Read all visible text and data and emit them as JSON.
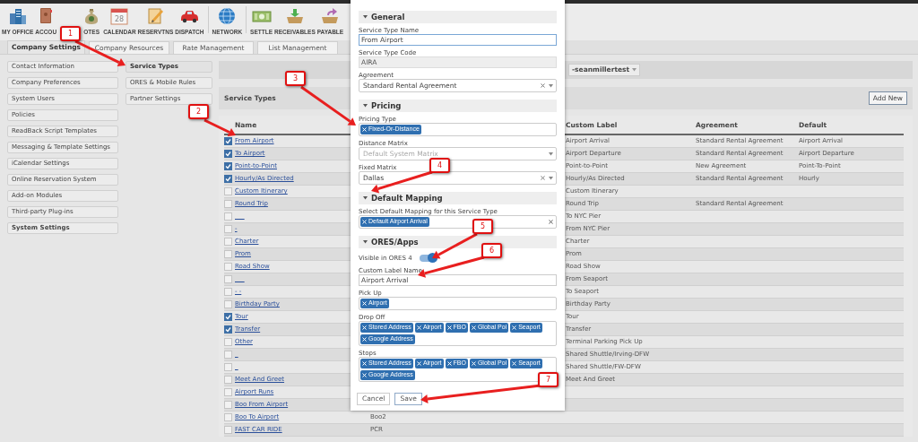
{
  "toolbar": [
    {
      "label": "MY OFFICE"
    },
    {
      "label": "ACCOU"
    },
    {
      "label": "OTES"
    },
    {
      "label": "CALENDAR",
      "icon_text": "28"
    },
    {
      "label": "RESERVTNS"
    },
    {
      "label": "DISPATCH"
    },
    {
      "label": "NETWORK"
    },
    {
      "label": "SETTLE"
    },
    {
      "label": "RECEIVABLES"
    },
    {
      "label": "PAYABLE"
    }
  ],
  "tabs": [
    {
      "label": "Company Settings",
      "selected": true
    },
    {
      "label": "Company Resources",
      "selected": false
    },
    {
      "label": "Rate Management",
      "selected": false
    },
    {
      "label": "List Management",
      "selected": false
    }
  ],
  "sidebar": {
    "items": [
      {
        "label": "Contact Information",
        "kind": "item"
      },
      {
        "label": "Company Preferences",
        "kind": "item"
      },
      {
        "label": "System Users",
        "kind": "item"
      },
      {
        "label": "Policies",
        "kind": "item"
      },
      {
        "label": "ReadBack Script Templates",
        "kind": "item"
      },
      {
        "label": "Messaging & Template Settings",
        "kind": "item"
      },
      {
        "label": "iCalendar Settings",
        "kind": "item"
      },
      {
        "label": "Online Reservation System",
        "kind": "item"
      },
      {
        "label": "Add-on Modules",
        "kind": "item"
      },
      {
        "label": "Third-party Plug-ins",
        "kind": "item"
      },
      {
        "label": "System Settings",
        "kind": "heading"
      }
    ]
  },
  "subnav": {
    "items": [
      {
        "label": "Service Types",
        "selected": true
      },
      {
        "label": "ORES & Mobile Rules",
        "selected": false
      },
      {
        "label": "Partner Settings",
        "selected": false
      }
    ]
  },
  "company_dropdown": {
    "value": "-seanmillertest"
  },
  "section": {
    "title": "Service Types",
    "add_button": "Add New"
  },
  "table": {
    "columns": [
      {
        "label": "Name"
      },
      {
        "label": "Custom Label"
      },
      {
        "label": "Agreement"
      },
      {
        "label": "Default"
      }
    ],
    "rows": [
      {
        "checked": true,
        "name": "From Airport",
        "custom_label": "Airport Arrival",
        "agreement": "Standard Rental Agreement",
        "default": "Airport Arrival"
      },
      {
        "checked": true,
        "name": "To Airport",
        "custom_label": "Airport Departure",
        "agreement": "Standard Rental Agreement",
        "default": "Airport Departure"
      },
      {
        "checked": true,
        "name": "Point-to-Point",
        "custom_label": "Point-to-Point",
        "agreement": "New Agreement",
        "default": "Point-To-Point"
      },
      {
        "checked": true,
        "name": "Hourly/As Directed",
        "custom_label": "Hourly/As Directed",
        "agreement": "Standard Rental Agreement",
        "default": "Hourly"
      },
      {
        "checked": false,
        "name": "Custom Itinerary",
        "custom_label": "Custom Itinerary"
      },
      {
        "checked": false,
        "name": "Round Trip",
        "custom_label": "Round Trip",
        "agreement": "Standard Rental Agreement"
      },
      {
        "checked": false,
        "name": "___",
        "custom_label": "To NYC Pier"
      },
      {
        "checked": false,
        "name": "-",
        "custom_label": "From NYC Pier"
      },
      {
        "checked": false,
        "name": "Charter",
        "custom_label": "Charter"
      },
      {
        "checked": false,
        "name": "Prom",
        "custom_label": "Prom"
      },
      {
        "checked": false,
        "name": "Road Show",
        "custom_label": "Road Show"
      },
      {
        "checked": false,
        "name": "___",
        "custom_label": "From Seaport"
      },
      {
        "checked": false,
        "name": "- -",
        "custom_label": "To Seaport"
      },
      {
        "checked": false,
        "name": "Birthday Party",
        "custom_label": "Birthday Party"
      },
      {
        "checked": true,
        "name": "Tour",
        "custom_label": "Tour"
      },
      {
        "checked": true,
        "name": "Transfer",
        "custom_label": "Transfer"
      },
      {
        "checked": false,
        "name": "Other",
        "custom_label": "Terminal Parking Pick Up"
      },
      {
        "checked": false,
        "name": "_",
        "custom_label": "Shared Shuttle/Irving-DFW"
      },
      {
        "checked": false,
        "name": "_",
        "custom_label": "Shared Shuttle/FW-DFW"
      },
      {
        "checked": false,
        "name": "Meet And Greet",
        "custom_label": "Meet And Greet"
      },
      {
        "checked": false,
        "name": "Airport Runs"
      },
      {
        "checked": false,
        "name": "Boo From Airport"
      },
      {
        "checked": false,
        "name": "Boo To Airport",
        "code": "Boo2"
      },
      {
        "checked": false,
        "name": "FAST CAR RIDE",
        "code": "PCR"
      }
    ]
  },
  "modal": {
    "sections": [
      {
        "title": "General",
        "fields": [
          {
            "kind": "text",
            "label": "Service Type Name",
            "value": "From Airport",
            "focused": true,
            "disabled": false
          },
          {
            "kind": "text",
            "label": "Service Type Code",
            "value": "AIRA",
            "focused": false,
            "disabled": true
          },
          {
            "kind": "select",
            "label": "Agreement",
            "value": "Standard Rental Agreement",
            "clearable": true
          }
        ]
      },
      {
        "title": "Pricing",
        "fields": [
          {
            "kind": "tags",
            "label": "Pricing Type",
            "tags": [
              "Fixed-Or-Distance"
            ],
            "clearable": false
          },
          {
            "kind": "select",
            "label": "Distance Matrix",
            "placeholder": "Default System Matrix",
            "clearable": false
          },
          {
            "kind": "select",
            "label": "Fixed Matrix",
            "value": "Dallas",
            "clearable": true
          }
        ]
      },
      {
        "title": "Default Mapping",
        "fields": [
          {
            "kind": "tags",
            "label": "Select Default Mapping for this Service Type",
            "tags": [
              "Default Airport Arrival"
            ],
            "clearable": true
          }
        ]
      },
      {
        "title": "ORES/Apps",
        "fields": [
          {
            "kind": "toggle",
            "label": "Visible in ORES 4",
            "on": true
          },
          {
            "kind": "text",
            "label": "Custom Label Name",
            "value": "Airport Arrival",
            "focused": false,
            "disabled": false
          },
          {
            "kind": "tags",
            "label": "Pick Up",
            "tags": [
              "Airport"
            ],
            "clearable": false
          },
          {
            "kind": "tags",
            "label": "Drop Off",
            "tags": [
              "Stored Address",
              "Airport",
              "FBO",
              "Global Poi",
              "Seaport",
              "Google Address"
            ],
            "clearable": false
          },
          {
            "kind": "tags",
            "label": "Stops",
            "tags": [
              "Stored Address",
              "Airport",
              "FBO",
              "Global Poi",
              "Seaport",
              "Google Address"
            ]
          }
        ]
      }
    ],
    "buttons": [
      {
        "label": "Cancel",
        "kind": "cancel"
      },
      {
        "label": "Save",
        "kind": "save"
      }
    ]
  },
  "callouts": [
    {
      "number": "1"
    },
    {
      "number": "2"
    },
    {
      "number": "3"
    },
    {
      "number": "4"
    },
    {
      "number": "5"
    },
    {
      "number": "6"
    },
    {
      "number": "7"
    }
  ]
}
